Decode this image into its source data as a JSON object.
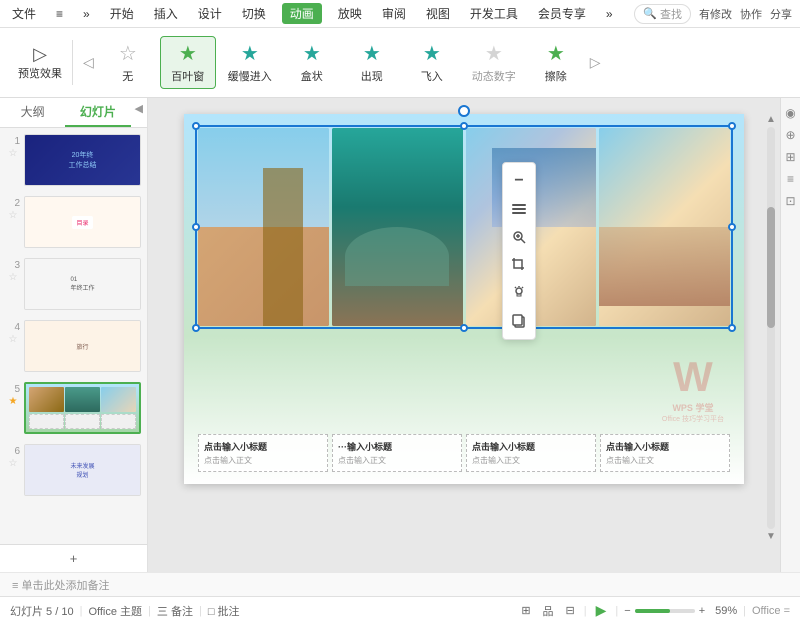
{
  "titlebar": {
    "menus": [
      "文件",
      "≡",
      "»",
      "开始",
      "插入",
      "设计",
      "切换",
      "动画",
      "放映",
      "审阅",
      "视图",
      "开发工具",
      "会员专享",
      "»"
    ],
    "active_menu": "动画",
    "search_placeholder": "查找",
    "icons": [
      "有修改",
      "协作",
      "分享"
    ]
  },
  "toolbar": {
    "preview_label": "预览效果",
    "items": [
      {
        "id": "none",
        "label": "无",
        "icon": "★"
      },
      {
        "id": "blind",
        "label": "百叶窗",
        "icon": "★",
        "selected": true
      },
      {
        "id": "fade",
        "label": "缓慢进入",
        "icon": "★"
      },
      {
        "id": "box",
        "label": "盒状",
        "icon": "★"
      },
      {
        "id": "appear",
        "label": "出现",
        "icon": "★"
      },
      {
        "id": "fly",
        "label": "飞入",
        "icon": "★"
      },
      {
        "id": "dynamic",
        "label": "动态数字",
        "icon": "★",
        "disabled": true
      },
      {
        "id": "wipe",
        "label": "擦除",
        "icon": "★"
      }
    ]
  },
  "sidebar": {
    "tabs": [
      "大纲",
      "幻灯片"
    ],
    "active_tab": "幻灯片",
    "slides": [
      {
        "num": "1",
        "star": false,
        "theme": "dark"
      },
      {
        "num": "2",
        "star": false,
        "theme": "light"
      },
      {
        "num": "3",
        "star": false,
        "theme": "gray"
      },
      {
        "num": "4",
        "star": false,
        "theme": "warm"
      },
      {
        "num": "5",
        "star": true,
        "theme": "blue",
        "active": true
      },
      {
        "num": "6",
        "star": false,
        "theme": "purple"
      }
    ],
    "add_label": "+"
  },
  "canvas": {
    "text_boxes": [
      {
        "title": "点击输入小标题",
        "body": "点击输入正文"
      },
      {
        "title": "···输入小标题",
        "body": "点击输入正文"
      },
      {
        "title": "点击输入小标题",
        "body": "点击输入正文"
      },
      {
        "title": "点击输入小标题",
        "body": "点击输入正文"
      }
    ]
  },
  "float_toolbar": {
    "buttons": [
      "−",
      "⊞",
      "⊕",
      "⊡",
      "💡",
      "⊕"
    ]
  },
  "notes": {
    "placeholder": "≡  单击此处添加备注"
  },
  "statusbar": {
    "slide_info": "幻灯片 5 / 10",
    "theme": "Office 主题",
    "notes_label": "三 备注",
    "comments_label": "□ 批注",
    "view_icons": [
      "⊞",
      "品",
      "⊟"
    ],
    "play_label": "▶",
    "zoom_level": "59%",
    "office_label": "Office ="
  },
  "wps": {
    "logo": "W",
    "tagline": "WPS 学堂",
    "subtitle": "Office 技巧学习平台"
  }
}
